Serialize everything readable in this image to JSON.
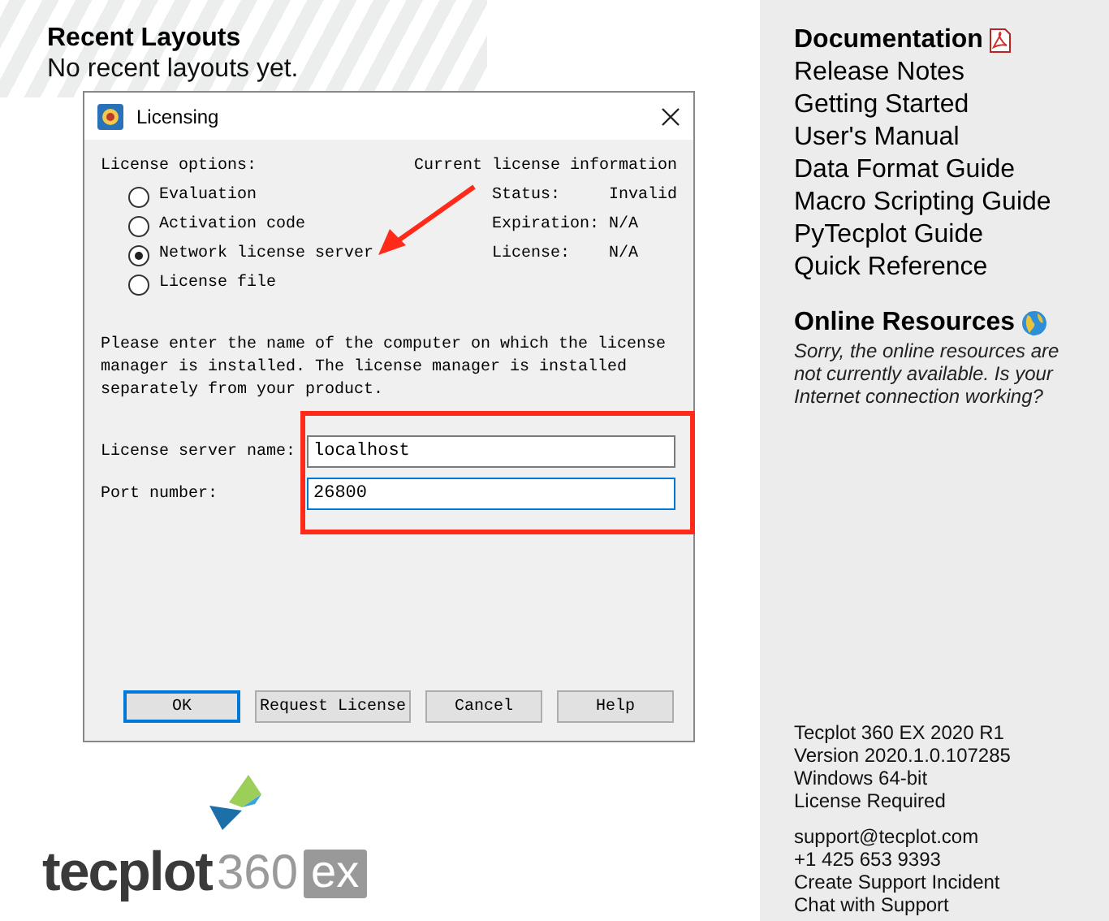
{
  "recent": {
    "title": "Recent Layouts",
    "message": "No recent layouts yet."
  },
  "dialog": {
    "title": "Licensing",
    "options_label": "License options:",
    "options": [
      {
        "label": "Evaluation",
        "selected": false
      },
      {
        "label": "Activation code",
        "selected": false
      },
      {
        "label": "Network license server",
        "selected": true
      },
      {
        "label": "License file",
        "selected": false
      }
    ],
    "info_title": "Current license information",
    "info": [
      {
        "label": "Status:",
        "value": "Invalid"
      },
      {
        "label": "Expiration:",
        "value": "N/A"
      },
      {
        "label": "License:",
        "value": "N/A"
      }
    ],
    "description": "Please enter the name of the computer on which the license manager is installed. The license manager is installed separately from your product.",
    "fields": [
      {
        "label": "License server name:",
        "value": "localhost",
        "focused": false
      },
      {
        "label": "Port number:",
        "value": "26800",
        "focused": true
      }
    ],
    "buttons": [
      {
        "label": "OK",
        "default": true
      },
      {
        "label": "Request License",
        "default": false
      },
      {
        "label": "Cancel",
        "default": false
      },
      {
        "label": "Help",
        "default": false
      }
    ]
  },
  "logo": {
    "name": "tecplot",
    "number": "360",
    "badge": "ex"
  },
  "documentation": {
    "title": "Documentation",
    "links": [
      "Release Notes",
      "Getting Started",
      "User's Manual",
      "Data Format Guide",
      "Macro Scripting Guide",
      "PyTecplot Guide",
      "Quick Reference"
    ]
  },
  "online": {
    "title": "Online Resources",
    "message": "Sorry, the online resources are not currently available. Is your Internet connection working?"
  },
  "product": [
    "Tecplot 360 EX 2020 R1",
    "Version 2020.1.0.107285",
    "Windows 64-bit",
    "License Required"
  ],
  "support": [
    "support@tecplot.com",
    "+1 425 653 9393",
    "Create Support Incident",
    "Chat with Support"
  ]
}
